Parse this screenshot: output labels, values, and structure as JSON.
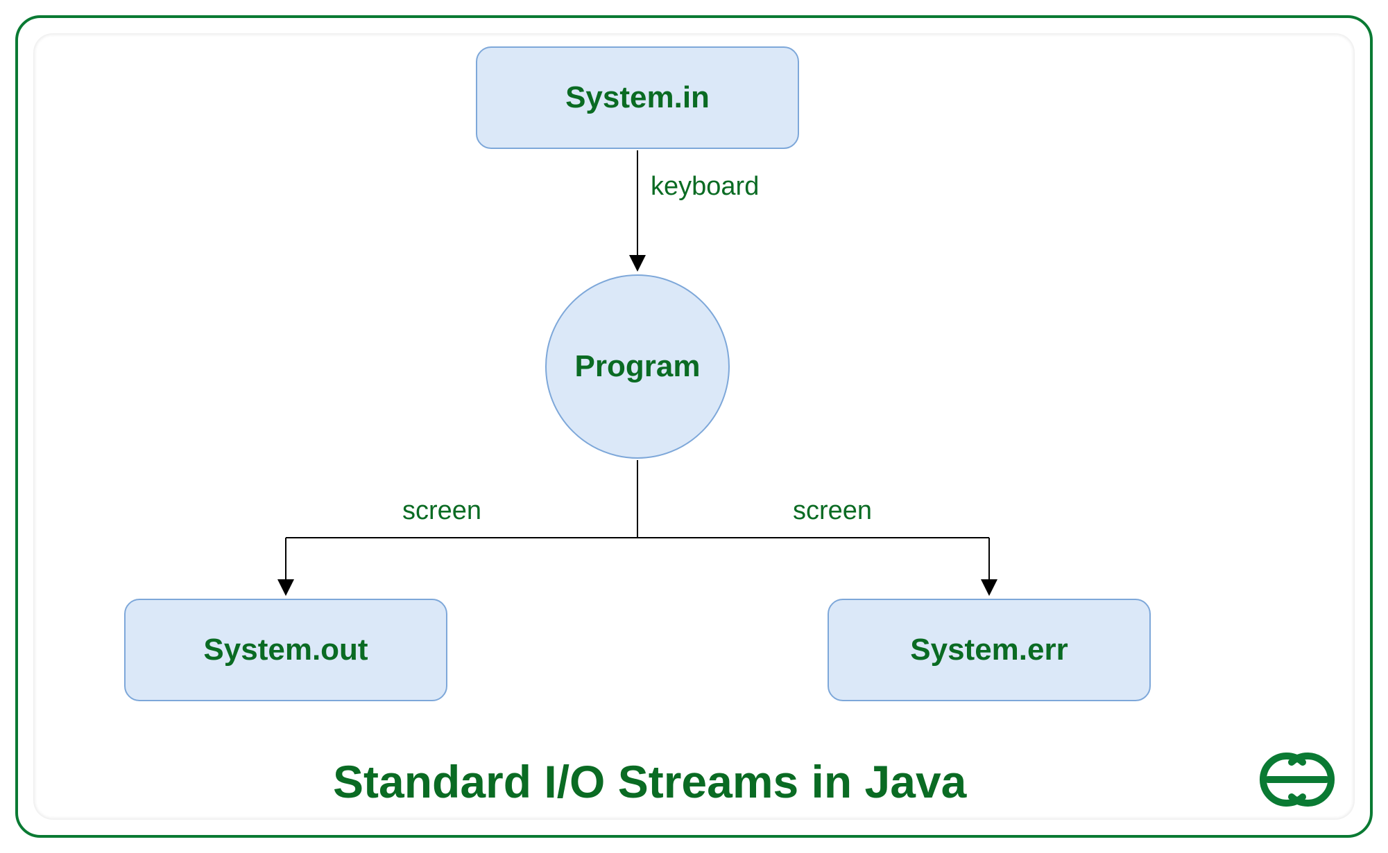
{
  "diagram": {
    "title": "Standard I/O Streams in Java",
    "nodes": {
      "system_in": {
        "label": "System.in"
      },
      "program": {
        "label": "Program"
      },
      "system_out": {
        "label": "System.out"
      },
      "system_err": {
        "label": "System.err"
      }
    },
    "edges": {
      "in_to_program": {
        "label": "keyboard"
      },
      "program_to_out": {
        "label": "screen"
      },
      "program_to_err": {
        "label": "screen"
      }
    },
    "logo": "GG"
  }
}
